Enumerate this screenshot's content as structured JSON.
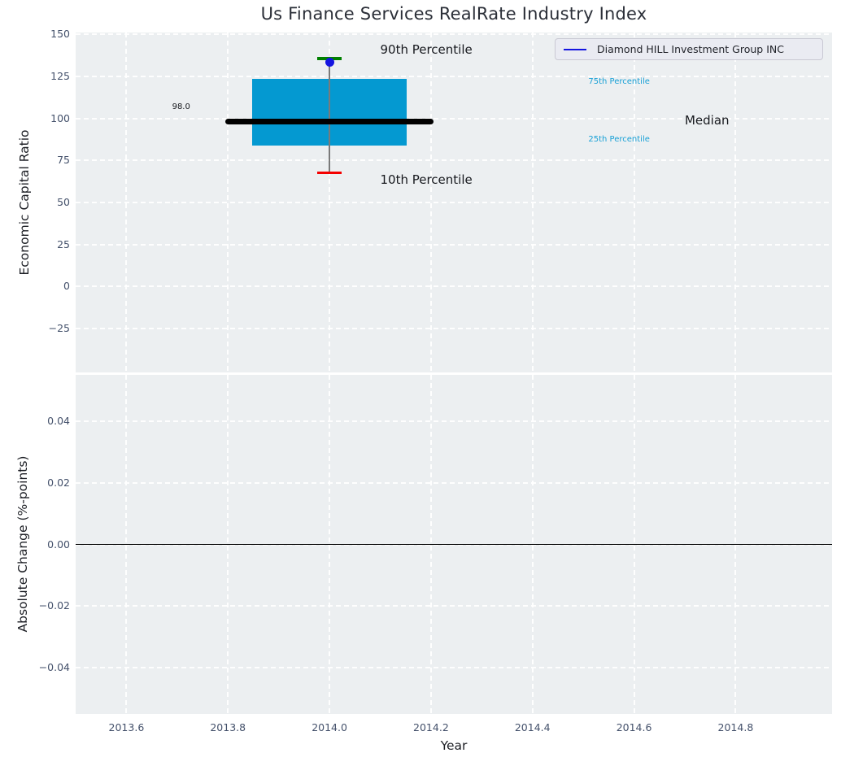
{
  "figure": {
    "title": "Us Finance Services RealRate Industry Index"
  },
  "legend": {
    "label": "Diamond HILL Investment Group INC"
  },
  "colors": {
    "axes_bg": "#eceff1",
    "grid": "#ffffff",
    "box_fill": "#0499d1",
    "median_line": "#000000",
    "p90_cap": "#008000",
    "p10_cap": "#f40000",
    "whisker": "#7a7a7a",
    "company_dot": "#1414e0",
    "legend_line": "#1414e0",
    "cyan_label": "#18a0d6",
    "dark_label": "#16181d",
    "tick_label": "#44516b",
    "zero_line": "#000000"
  },
  "chart_data": [
    {
      "type": "box",
      "title": "Us Finance Services RealRate Industry Index",
      "ylabel": "Economic Capital Ratio",
      "xlim": [
        2013.5,
        2014.99
      ],
      "ylim": [
        -51,
        151
      ],
      "yticks": [
        150,
        125,
        100,
        75,
        50,
        25,
        0,
        -25
      ],
      "yticklabels": [
        "150",
        "125",
        "100",
        "75",
        "50",
        "25",
        "0",
        "−25"
      ],
      "xticks": [
        2013.6,
        2013.8,
        2014.0,
        2014.2,
        2014.4,
        2014.6,
        2014.8
      ],
      "xticklabels": [
        "2013.6",
        "2013.8",
        "2014.0",
        "2014.2",
        "2014.4",
        "2014.6",
        "2014.8"
      ],
      "grid": "white-dashed",
      "legend_position": "upper right",
      "box": {
        "x": 2014.0,
        "p10": 67.5,
        "q1": 84,
        "median": 98,
        "q3": 123.5,
        "p90": 135.5,
        "company_value": 133.2,
        "median_label": "98.0",
        "box_halfwidth": 0.152,
        "median_halfwidth": 0.205,
        "cap_halfwidth": 0.024
      },
      "annotations": [
        {
          "text": "90th Percentile",
          "x": 2014.1,
          "y": 140.4,
          "size": 15,
          "color": "dark"
        },
        {
          "text": "10th Percentile",
          "x": 2014.1,
          "y": 63.2,
          "size": 15,
          "color": "dark"
        },
        {
          "text": "75th Percentile",
          "x": 2014.51,
          "y": 121.5,
          "size": 10,
          "color": "cyan"
        },
        {
          "text": "25th Percentile",
          "x": 2014.51,
          "y": 87.2,
          "size": 10,
          "color": "cyan"
        },
        {
          "text": "Median",
          "x": 2014.7,
          "y": 98.3,
          "size": 15,
          "color": "dark"
        },
        {
          "text": "98.0",
          "x": 2013.69,
          "y": 106.3,
          "size": 10,
          "color": "dark"
        }
      ]
    },
    {
      "type": "line",
      "ylabel": "Absolute Change (%-points)",
      "xlabel": "Year",
      "xlim": [
        2013.5,
        2014.99
      ],
      "ylim": [
        -0.055,
        0.055
      ],
      "yticks": [
        0.04,
        0.02,
        0.0,
        -0.02,
        -0.04
      ],
      "yticklabels": [
        "0.04",
        "0.02",
        "0.00",
        "−0.02",
        "−0.04"
      ],
      "xticks": [
        2013.6,
        2013.8,
        2014.0,
        2014.2,
        2014.4,
        2014.6,
        2014.8
      ],
      "xticklabels": [
        "2013.6",
        "2013.8",
        "2014.0",
        "2014.2",
        "2014.4",
        "2014.6",
        "2014.8"
      ],
      "grid": "white-dashed",
      "zero_line": 0.0,
      "series": []
    }
  ]
}
